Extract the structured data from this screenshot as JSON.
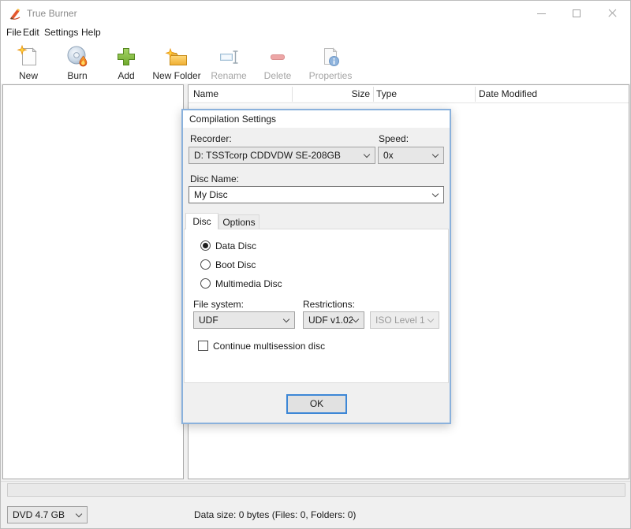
{
  "window": {
    "title": "True Burner"
  },
  "menu": {
    "items": [
      "File",
      "Edit",
      "Settings",
      "Help"
    ]
  },
  "toolbar": {
    "buttons": [
      {
        "label": "New",
        "icon": "new-document-icon",
        "enabled": true
      },
      {
        "label": "Burn",
        "icon": "burn-disc-icon",
        "enabled": true
      },
      {
        "label": "Add",
        "icon": "add-plus-icon",
        "enabled": true
      },
      {
        "label": "New Folder",
        "icon": "new-folder-icon",
        "enabled": true
      },
      {
        "label": "Rename",
        "icon": "rename-textbox-icon",
        "enabled": false
      },
      {
        "label": "Delete",
        "icon": "delete-minus-icon",
        "enabled": false
      },
      {
        "label": "Properties",
        "icon": "properties-info-icon",
        "enabled": false
      }
    ]
  },
  "file_list": {
    "columns": [
      {
        "label": "Name"
      },
      {
        "label": "Size"
      },
      {
        "label": "Type"
      },
      {
        "label": "Date Modified"
      }
    ],
    "rows": []
  },
  "dialog": {
    "title": "Compilation Settings",
    "recorder_label": "Recorder:",
    "recorder_value": "D: TSSTcorp CDDVDW SE-208GB",
    "speed_label": "Speed:",
    "speed_value": "0x",
    "disc_name_label": "Disc Name:",
    "disc_name_value": "My Disc",
    "tabs": [
      {
        "label": "Disc",
        "active": true
      },
      {
        "label": "Options",
        "active": false
      }
    ],
    "disc_types": [
      {
        "label": "Data Disc",
        "selected": true
      },
      {
        "label": "Boot Disc",
        "selected": false
      },
      {
        "label": "Multimedia Disc",
        "selected": false
      }
    ],
    "file_system_label": "File system:",
    "file_system_value": "UDF",
    "restrictions_label": "Restrictions:",
    "restrictions_value": "UDF v1.02",
    "iso_level_value": "ISO Level 1",
    "iso_level_enabled": false,
    "multisession_label": "Continue multisession disc",
    "multisession_checked": false,
    "ok_label": "OK"
  },
  "statusbar": {
    "capacity_value": "DVD 4.7 GB",
    "data_size_text": "Data size: 0 bytes (Files: 0, Folders: 0)",
    "progress_percent": 0
  },
  "colors": {
    "accent": "#0078d7",
    "dialog_border": "#8ab1dc",
    "add_green": "#76b82a",
    "folder_yellow": "#f2b33d",
    "flame_orange": "#e8731c",
    "disabled_text": "#a5a5a5"
  }
}
